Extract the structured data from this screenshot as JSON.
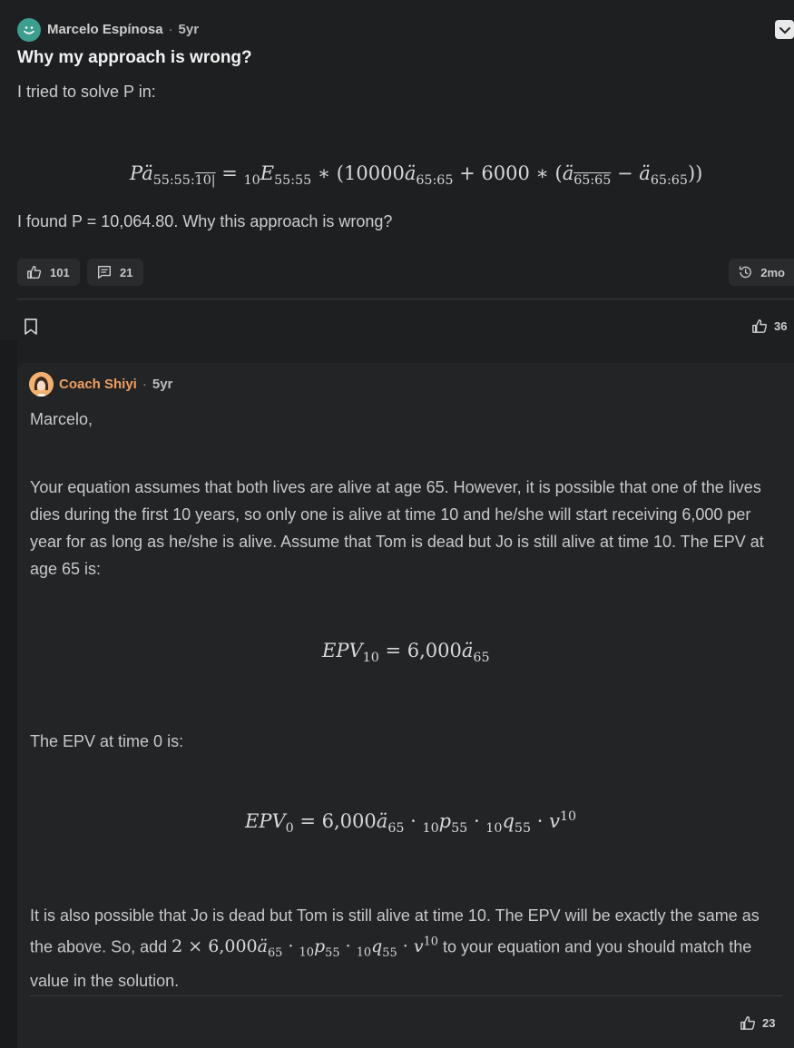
{
  "post": {
    "author": "Marcelo Espínosa",
    "age": "5yr",
    "title": "Why my approach is wrong?",
    "intro": "I tried to solve P in:",
    "result_text": "I found P = 10,064.80. Why this approach is wrong?",
    "likes": "101",
    "comments": "21",
    "history": "2mo",
    "vote_count": "36"
  },
  "reply": {
    "author": "Coach Shiyi",
    "age": "5yr",
    "greeting": "Marcelo,",
    "para1": "Your equation assumes that both lives are alive at age 65. However, it is possible that one of the lives dies during the first 10 years, so only one is alive at time 10 and he/she will start receiving 6,000 per year for as long as he/she is alive. Assume that Tom is dead but Jo is still alive at time 10. The EPV at age 65 is:",
    "epv_time0_label": "The EPV at time 0 is:",
    "para3_a": "It is also possible that Jo is dead but Tom is still alive at time 10. The EPV will be exactly the same as the above. So, add",
    "para3_b": "to your equation and you should match the value in the solution.",
    "likes": "23"
  },
  "icons": {
    "avatar": "smiley-avatar",
    "corner": "chevron-badge-icon",
    "like": "thumbs-up-icon",
    "comment": "comment-icon",
    "history": "history-icon",
    "bookmark": "bookmark-icon"
  },
  "colors": {
    "background": "#1e1f21",
    "reply_background": "#232426",
    "accent_coach": "#f0a060",
    "avatar_teal": "#3c9e8e"
  }
}
